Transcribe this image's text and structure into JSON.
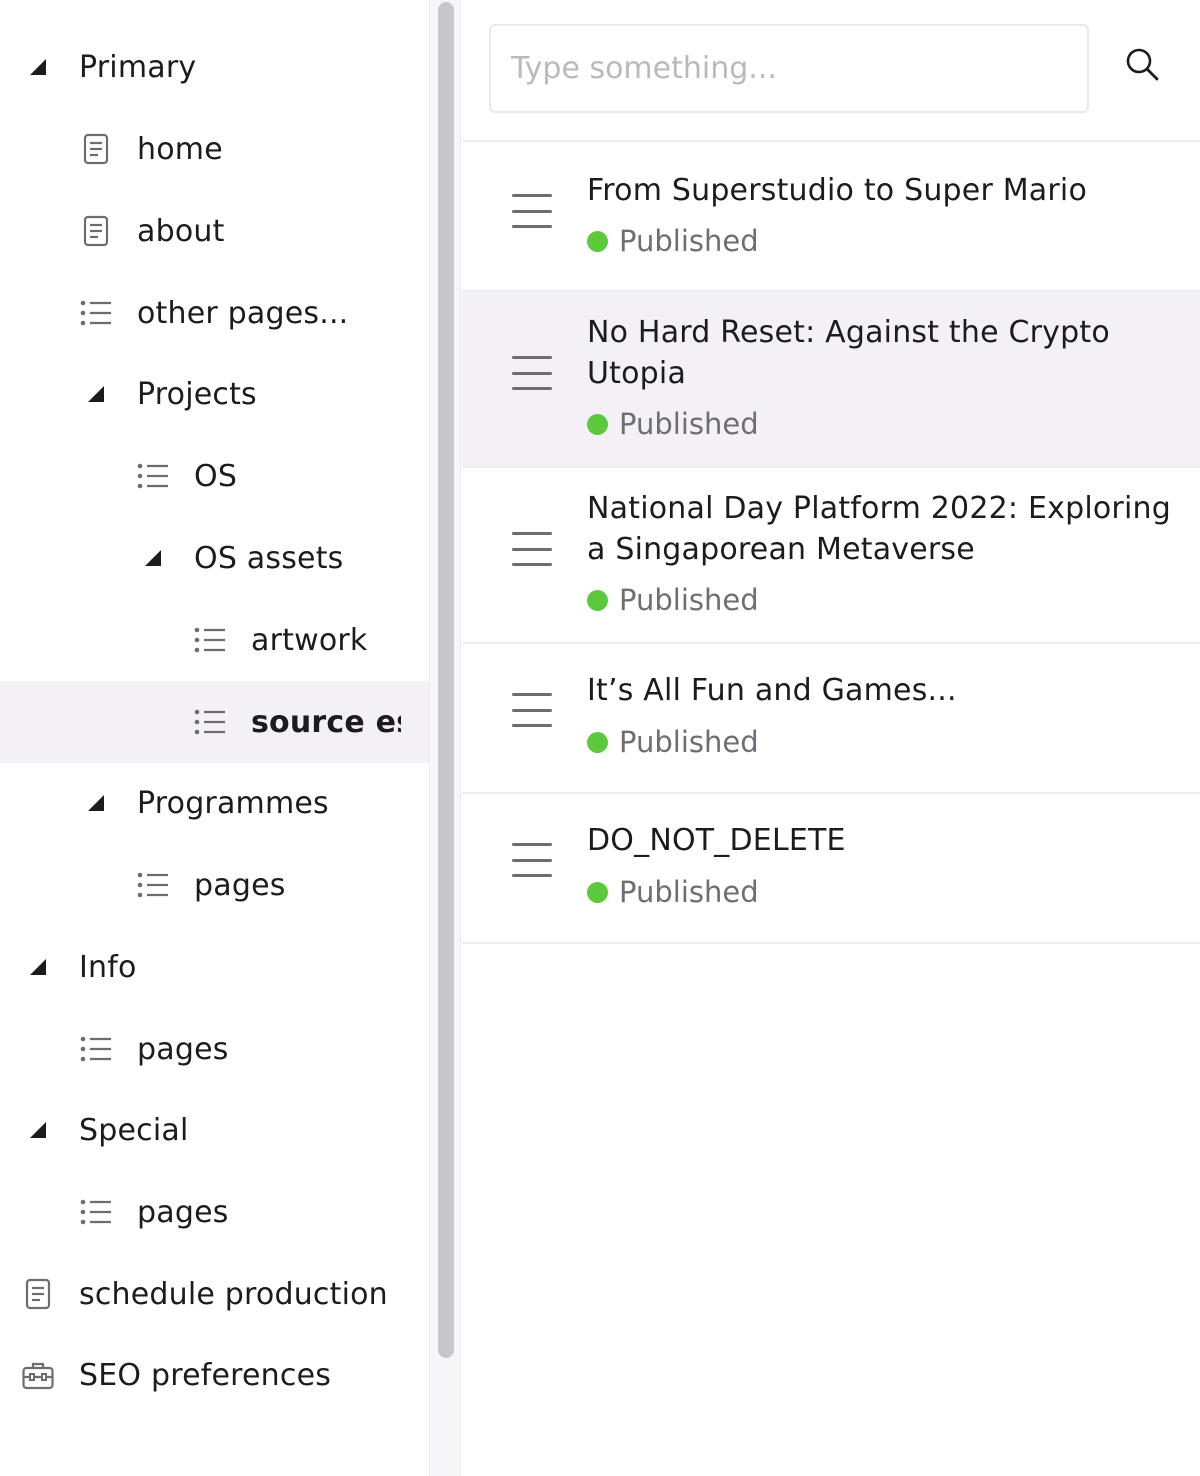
{
  "sidebar": {
    "items": [
      {
        "label": "Primary",
        "icon": "triangle-collapse-icon"
      },
      {
        "label": "home",
        "icon": "document-icon"
      },
      {
        "label": "about",
        "icon": "document-icon"
      },
      {
        "label": "other pages...",
        "icon": "list-icon"
      },
      {
        "label": "Projects",
        "icon": "triangle-collapse-icon"
      },
      {
        "label": "OS",
        "icon": "list-icon"
      },
      {
        "label": "OS assets",
        "icon": "triangle-collapse-icon"
      },
      {
        "label": "artwork",
        "icon": "list-icon"
      },
      {
        "label": "source ess",
        "icon": "list-icon",
        "selected": true
      },
      {
        "label": "Programmes",
        "icon": "triangle-collapse-icon"
      },
      {
        "label": "pages",
        "icon": "list-icon"
      },
      {
        "label": "Info",
        "icon": "triangle-collapse-icon"
      },
      {
        "label": "pages",
        "icon": "list-icon"
      },
      {
        "label": "Special",
        "icon": "triangle-collapse-icon"
      },
      {
        "label": "pages",
        "icon": "list-icon"
      },
      {
        "label": "schedule production",
        "icon": "document-icon"
      },
      {
        "label": "SEO preferences",
        "icon": "toolbox-icon"
      }
    ]
  },
  "search": {
    "placeholder": "Type something...",
    "icon": "search-icon"
  },
  "documents": {
    "status_color": "#5cc93c",
    "items": [
      {
        "title": "From Superstudio to Super Mario",
        "status": "Published"
      },
      {
        "title": "No Hard Reset: Against the Crypto Utopia",
        "status": "Published"
      },
      {
        "title": "National Day Platform 2022: Exploring a Singaporean Metaverse",
        "status": "Published"
      },
      {
        "title": "It’s All Fun and Games...",
        "status": "Published"
      },
      {
        "title": "DO_NOT_DELETE",
        "status": "Published"
      }
    ]
  }
}
